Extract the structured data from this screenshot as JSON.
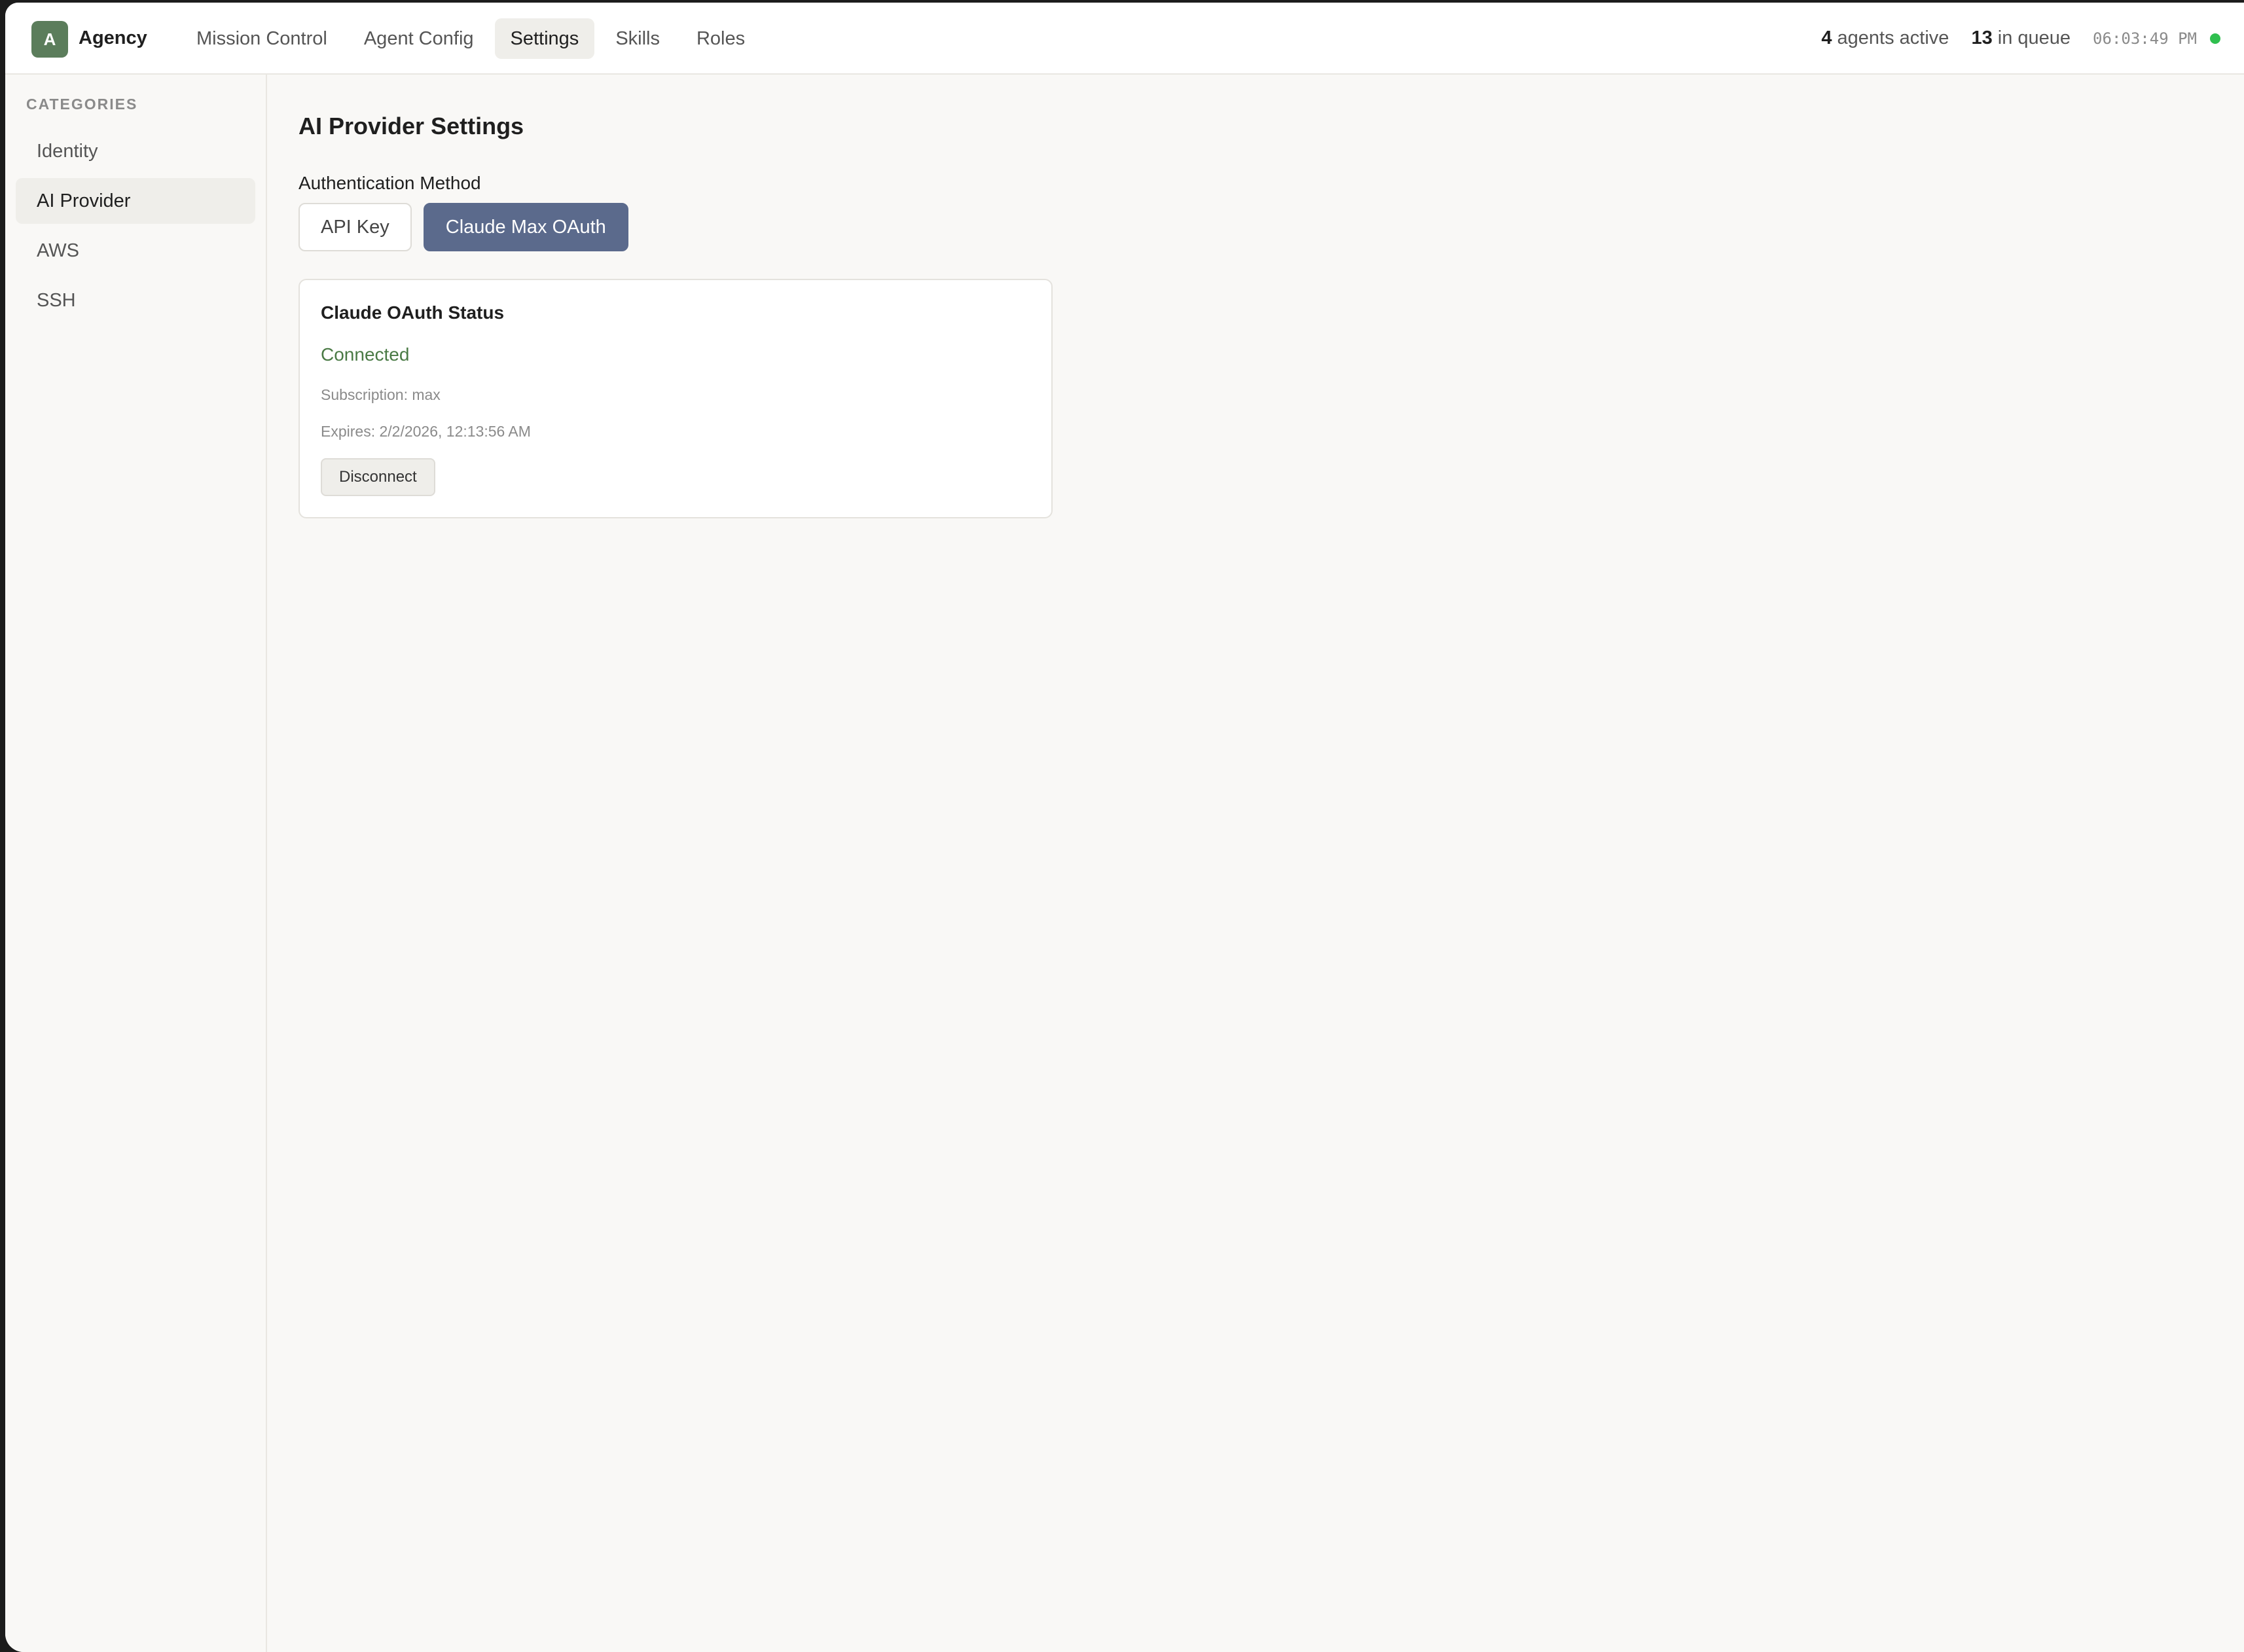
{
  "app": {
    "logo_letter": "A",
    "name": "Agency"
  },
  "nav": {
    "items": [
      {
        "label": "Mission Control"
      },
      {
        "label": "Agent Config"
      },
      {
        "label": "Settings",
        "active": true
      },
      {
        "label": "Skills"
      },
      {
        "label": "Roles"
      }
    ]
  },
  "header_stats": {
    "agents_count": "4",
    "agents_label": "agents active",
    "queue_count": "13",
    "queue_label": "in queue",
    "clock": "06:03:49 PM",
    "status_color": "#2fbf4f"
  },
  "sidebar": {
    "heading": "CATEGORIES",
    "items": [
      {
        "label": "Identity"
      },
      {
        "label": "AI Provider",
        "active": true
      },
      {
        "label": "AWS"
      },
      {
        "label": "SSH"
      }
    ]
  },
  "main": {
    "title": "AI Provider Settings",
    "auth_label": "Authentication Method",
    "auth_options": [
      {
        "label": "API Key",
        "selected": false
      },
      {
        "label": "Claude Max OAuth",
        "selected": true
      }
    ],
    "status_card": {
      "title": "Claude OAuth Status",
      "status": "Connected",
      "subscription": "Subscription: max",
      "expires": "Expires: 2/2/2026, 12:13:56 AM",
      "disconnect_label": "Disconnect"
    }
  },
  "colors": {
    "brand": "#5b7d5b",
    "accent": "#5b6a8c",
    "connected": "#4a7a45"
  }
}
